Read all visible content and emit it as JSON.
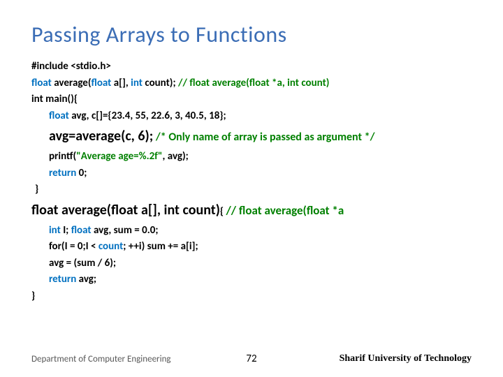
{
  "title": "Passing Arrays to Functions",
  "code": {
    "l1a": "#include ",
    "l1b": "<stdio.h>",
    "l2a": "float ",
    "l2b": "average(",
    "l2c": "float ",
    "l2d": "a[], ",
    "l2e": "int ",
    "l2f": "count); ",
    "l2g": "// float average(float  *a, int count)",
    "l3": "int main(){",
    "l4a": "float ",
    "l4b": "avg, c[]={23.4, 55, 22.6, 3, 40.5, 18};",
    "l5a": "avg=average(c, 6);",
    "l5b": "   /* Only name of array is passed as argument */",
    "l6a": "printf(",
    "l6b": "\"Average age=%.2f\"",
    "l6c": ", avg);",
    "l7a": "return ",
    "l7b": "0;",
    "l8": "}",
    "l9a": "float average(float a[], int count)",
    "l9b": "{ ",
    "l9c": "// float average(float  *a",
    "l10a": "int ",
    "l10b": "I;  ",
    "l10c": "float ",
    "l10d": "avg, sum = 0.0;",
    "l11a": "for(I = 0;I < ",
    "l11b": "count",
    "l11c": "; ++i)  sum += a[i];",
    "l12": "avg = (sum / 6);",
    "l13a": "return ",
    "l13b": "avg;",
    "l14": "}"
  },
  "footer": {
    "left": "Department of Computer Engineering",
    "center": "72",
    "right": "Sharif University of Technology"
  }
}
